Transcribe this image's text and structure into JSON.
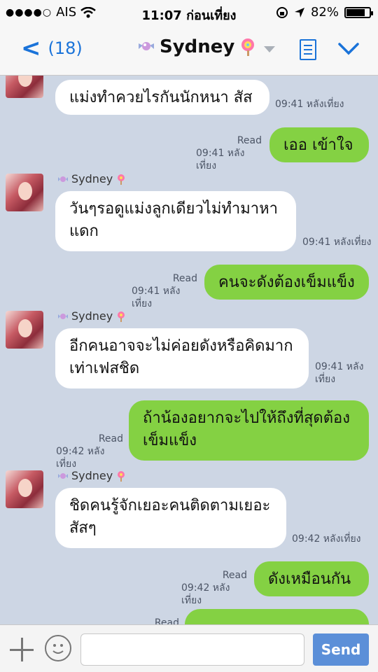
{
  "status_bar": {
    "carrier": "AIS",
    "time": "11:07 ก่อนเที่ยง",
    "battery": "82%",
    "battery_level": 0.82
  },
  "nav": {
    "back_count": "(18)",
    "title": "Sydney"
  },
  "messages": [
    {
      "text": "แม่งทำควยไรกันนักหนา สัส",
      "time": "09:41 หลังเที่ยง"
    },
    {
      "text": "เออ เข้าใจ",
      "read": "Read",
      "time": "09:41 หลังเที่ยง"
    },
    {
      "sender": "Sydney",
      "text": "วันๆรอดูแม่งลูกเดียวไม่ทำมาหาแดก",
      "time": "09:41 หลังเที่ยง"
    },
    {
      "text": "คนจะดังต้องเข็มแข็ง",
      "read": "Read",
      "time": "09:41 หลังเที่ยง"
    },
    {
      "sender": "Sydney",
      "text": "อีกคนอาจจะไม่ค่อยดังหรือคิดมากเท่าเฟสชิด",
      "time": "09:41 หลังเที่ยง"
    },
    {
      "text": "ถ้าน้องอยากจะไปให้ถึงที่สุดต้องเข็มแข็ง",
      "read": "Read",
      "time": "09:42 หลังเที่ยง"
    },
    {
      "sender": "Sydney",
      "text": "ชิดคนรู้จักเยอะคนติดตามเยอะสัสๆ",
      "time": "09:42 หลังเที่ยง"
    },
    {
      "text": "ดังเหมือนกัน",
      "read": "Read",
      "time": "09:42 หลังเที่ยง"
    },
    {
      "read": "Read"
    }
  ],
  "input": {
    "placeholder": "",
    "send_label": "Send"
  }
}
